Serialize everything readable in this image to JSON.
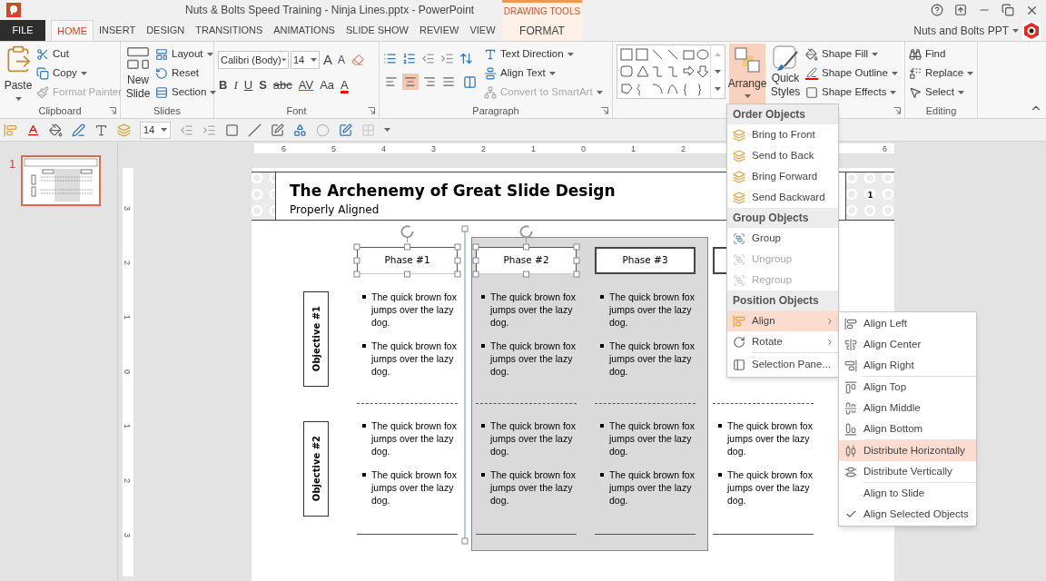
{
  "window": {
    "title": "Nuts & Bolts Speed Training - Ninja Lines.pptx - PowerPoint",
    "contextual_group": "DRAWING TOOLS",
    "account": "Nuts and Bolts PPT"
  },
  "tabs": [
    {
      "label": "FILE",
      "kind": "file",
      "selected": false
    },
    {
      "label": "HOME",
      "kind": "normal",
      "selected": true
    },
    {
      "label": "INSERT",
      "kind": "normal",
      "selected": false
    },
    {
      "label": "DESIGN",
      "kind": "normal",
      "selected": false
    },
    {
      "label": "TRANSITIONS",
      "kind": "normal",
      "selected": false
    },
    {
      "label": "ANIMATIONS",
      "kind": "normal",
      "selected": false
    },
    {
      "label": "SLIDE SHOW",
      "kind": "normal",
      "selected": false
    },
    {
      "label": "REVIEW",
      "kind": "normal",
      "selected": false
    },
    {
      "label": "VIEW",
      "kind": "normal",
      "selected": false
    },
    {
      "label": "FORMAT",
      "kind": "contextual",
      "selected": false
    }
  ],
  "ribbon": {
    "clipboard": {
      "label": "Clipboard",
      "paste": "Paste",
      "commands": [
        {
          "label": "Cut",
          "dropdown": false,
          "disabled": false
        },
        {
          "label": "Copy",
          "dropdown": true,
          "disabled": false
        },
        {
          "label": "Format Painter",
          "dropdown": false,
          "disabled": true
        }
      ]
    },
    "slides": {
      "label": "Slides",
      "new_slide": "New Slide",
      "commands": [
        {
          "label": "Layout",
          "dropdown": true
        },
        {
          "label": "Reset",
          "dropdown": false
        },
        {
          "label": "Section",
          "dropdown": true
        }
      ]
    },
    "font": {
      "label": "Font",
      "font_name": "Calibri (Body)",
      "font_size": "14",
      "size_buttons": [
        "A",
        "A"
      ],
      "format_buttons": [
        {
          "label": "B",
          "kind": "bold"
        },
        {
          "label": "I",
          "kind": "italic"
        },
        {
          "label": "U",
          "kind": "underline"
        },
        {
          "label": "S",
          "kind": "shadow"
        },
        {
          "label": "abc",
          "kind": "strike"
        },
        {
          "label": "AV",
          "kind": "spacing"
        },
        {
          "label": "Aa",
          "kind": "case"
        },
        {
          "label": "A",
          "kind": "color"
        }
      ]
    },
    "paragraph": {
      "label": "Paragraph",
      "alignment": [
        {
          "selected": false
        },
        {
          "selected": true
        },
        {
          "selected": false
        },
        {
          "selected": false
        }
      ],
      "commands": [
        {
          "label": "Text Direction",
          "disabled": false
        },
        {
          "label": "Align Text",
          "disabled": false
        },
        {
          "label": "Convert to SmartArt",
          "disabled": true
        }
      ]
    },
    "drawing": {
      "arrange": {
        "label": "Arrange",
        "selected": true
      },
      "quick_styles": "Quick Styles",
      "commands": [
        "Shape Fill",
        "Shape Outline",
        "Shape Effects"
      ]
    },
    "editing": {
      "label": "Editing",
      "commands": [
        {
          "label": "Find",
          "dropdown": false
        },
        {
          "label": "Replace",
          "dropdown": true
        },
        {
          "label": "Select",
          "dropdown": true
        }
      ]
    }
  },
  "quick_toolbar": {
    "font_size": "14"
  },
  "ruler": {
    "left_labels": [
      "6",
      "5",
      "4",
      "3",
      "2",
      "1",
      "0",
      "1",
      "2"
    ],
    "right_label": "6",
    "vertical_labels": [
      "3",
      "2",
      "1",
      "0",
      "1",
      "2",
      "3"
    ]
  },
  "thumbnails": [
    {
      "number": "1",
      "selected": true
    }
  ],
  "slide": {
    "title": "The Archenemy of Great Slide Design",
    "subtitle": "Properly Aligned",
    "page_number": "1",
    "objectives": [
      "Objective #1",
      "Objective #2"
    ],
    "columns": [
      {
        "phase": "Phase #1",
        "selected": true,
        "cells": [
          [
            "The quick brown fox jumps over the lazy dog.",
            "The quick brown fox jumps over the lazy dog."
          ],
          [
            "The quick brown fox jumps over the lazy dog.",
            "The quick brown fox jumps over the lazy dog."
          ]
        ]
      },
      {
        "phase": "Phase #2",
        "selected": true,
        "cells": [
          [
            "The quick brown fox jumps over the lazy dog.",
            "The quick brown fox jumps over the lazy dog."
          ],
          [
            "The quick brown fox jumps over the lazy dog.",
            "The quick brown fox jumps over the lazy dog."
          ]
        ]
      },
      {
        "phase": "Phase #3",
        "selected": false,
        "cells": [
          [
            "The quick brown fox jumps over the lazy dog.",
            "The quick brown fox jumps over the lazy dog."
          ],
          [
            "The quick brown fox jumps over the lazy dog.",
            "The quick brown fox jumps over the lazy dog."
          ]
        ]
      },
      {
        "selected": false,
        "cells": [
          null,
          [
            "The quick brown fox jumps over the lazy dog.",
            "The quick brown fox jumps over the lazy dog."
          ]
        ]
      }
    ]
  },
  "arrange_menu": {
    "sections": [
      {
        "heading": "Order Objects",
        "items": [
          {
            "label": "Bring to Front",
            "disabled": false,
            "selected": false,
            "submenu": false
          },
          {
            "label": "Send to Back",
            "disabled": false,
            "selected": false,
            "submenu": false
          },
          {
            "label": "Bring Forward",
            "disabled": false,
            "selected": false,
            "submenu": false
          },
          {
            "label": "Send Backward",
            "disabled": false,
            "selected": false,
            "submenu": false
          }
        ]
      },
      {
        "heading": "Group Objects",
        "items": [
          {
            "label": "Group",
            "disabled": false,
            "selected": false,
            "submenu": false
          },
          {
            "label": "Ungroup",
            "disabled": true,
            "selected": false,
            "submenu": false
          },
          {
            "label": "Regroup",
            "disabled": true,
            "selected": false,
            "submenu": false
          }
        ]
      },
      {
        "heading": "Position Objects",
        "items": [
          {
            "label": "Align",
            "disabled": false,
            "selected": true,
            "submenu": true
          },
          {
            "label": "Rotate",
            "disabled": false,
            "selected": false,
            "submenu": true
          },
          {
            "label": "Selection Pane...",
            "disabled": false,
            "selected": false,
            "submenu": false
          }
        ]
      }
    ]
  },
  "align_menu": {
    "groups": [
      [
        {
          "label": "Align Left",
          "selected": false,
          "checked": false
        },
        {
          "label": "Align Center",
          "selected": false,
          "checked": false
        },
        {
          "label": "Align Right",
          "selected": false,
          "checked": false
        }
      ],
      [
        {
          "label": "Align Top",
          "selected": false,
          "checked": false
        },
        {
          "label": "Align Middle",
          "selected": false,
          "checked": false
        },
        {
          "label": "Align Bottom",
          "selected": false,
          "checked": false
        }
      ],
      [
        {
          "label": "Distribute Horizontally",
          "selected": true,
          "checked": false
        },
        {
          "label": "Distribute Vertically",
          "selected": false,
          "checked": false
        }
      ],
      [
        {
          "label": "Align to Slide",
          "selected": false,
          "checked": false
        },
        {
          "label": "Align Selected Objects",
          "selected": false,
          "checked": true
        }
      ]
    ]
  }
}
